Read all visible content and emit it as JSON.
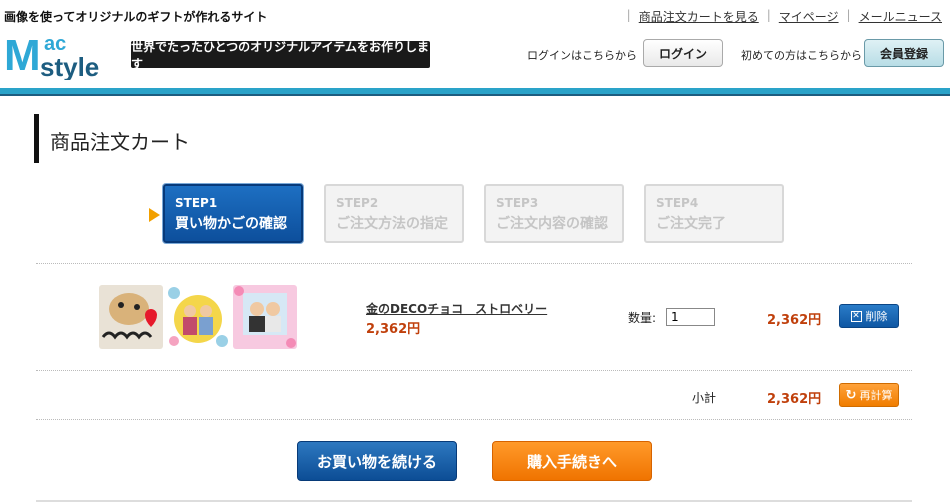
{
  "header": {
    "tagline": "画像を使ってオリジナルのギフトが作れるサイト",
    "links": [
      "商品注文カートを見る",
      "マイページ",
      "メールニュース"
    ],
    "logo": {
      "line1": "ac",
      "line2": "style",
      "initial": "M"
    },
    "slogan": "世界でたったひとつのオリジナルアイテムをお作りします",
    "login_text": "ログインはこちらから",
    "login_button": "ログイン",
    "first_text": "初めての方はこちらから",
    "register_button": "会員登録"
  },
  "page_title": "商品注文カート",
  "steps": [
    {
      "num": "STEP1",
      "label": "買い物かごの確認",
      "active": true
    },
    {
      "num": "STEP2",
      "label": "ご注文方法の指定",
      "active": false
    },
    {
      "num": "STEP3",
      "label": "ご注文内容の確認",
      "active": false
    },
    {
      "num": "STEP4",
      "label": "ご注文完了",
      "active": false
    }
  ],
  "cart": {
    "item": {
      "name": "金のDECOチョコ　ストロベリー",
      "price": "2,362円",
      "quantity_label": "数量:",
      "quantity": "1",
      "line_total": "2,362円",
      "delete_label": "削除"
    },
    "subtotal_label": "小計",
    "subtotal_value": "2,362円",
    "recalc_label": "再計算"
  },
  "actions": {
    "continue_label": "お買い物を続ける",
    "checkout_label": "購入手続きへ"
  },
  "colors": {
    "accent_blue": "#0d4f9c",
    "accent_orange": "#f07d00",
    "price_red": "#c0400c",
    "header_rule": "#2aa3c9"
  }
}
